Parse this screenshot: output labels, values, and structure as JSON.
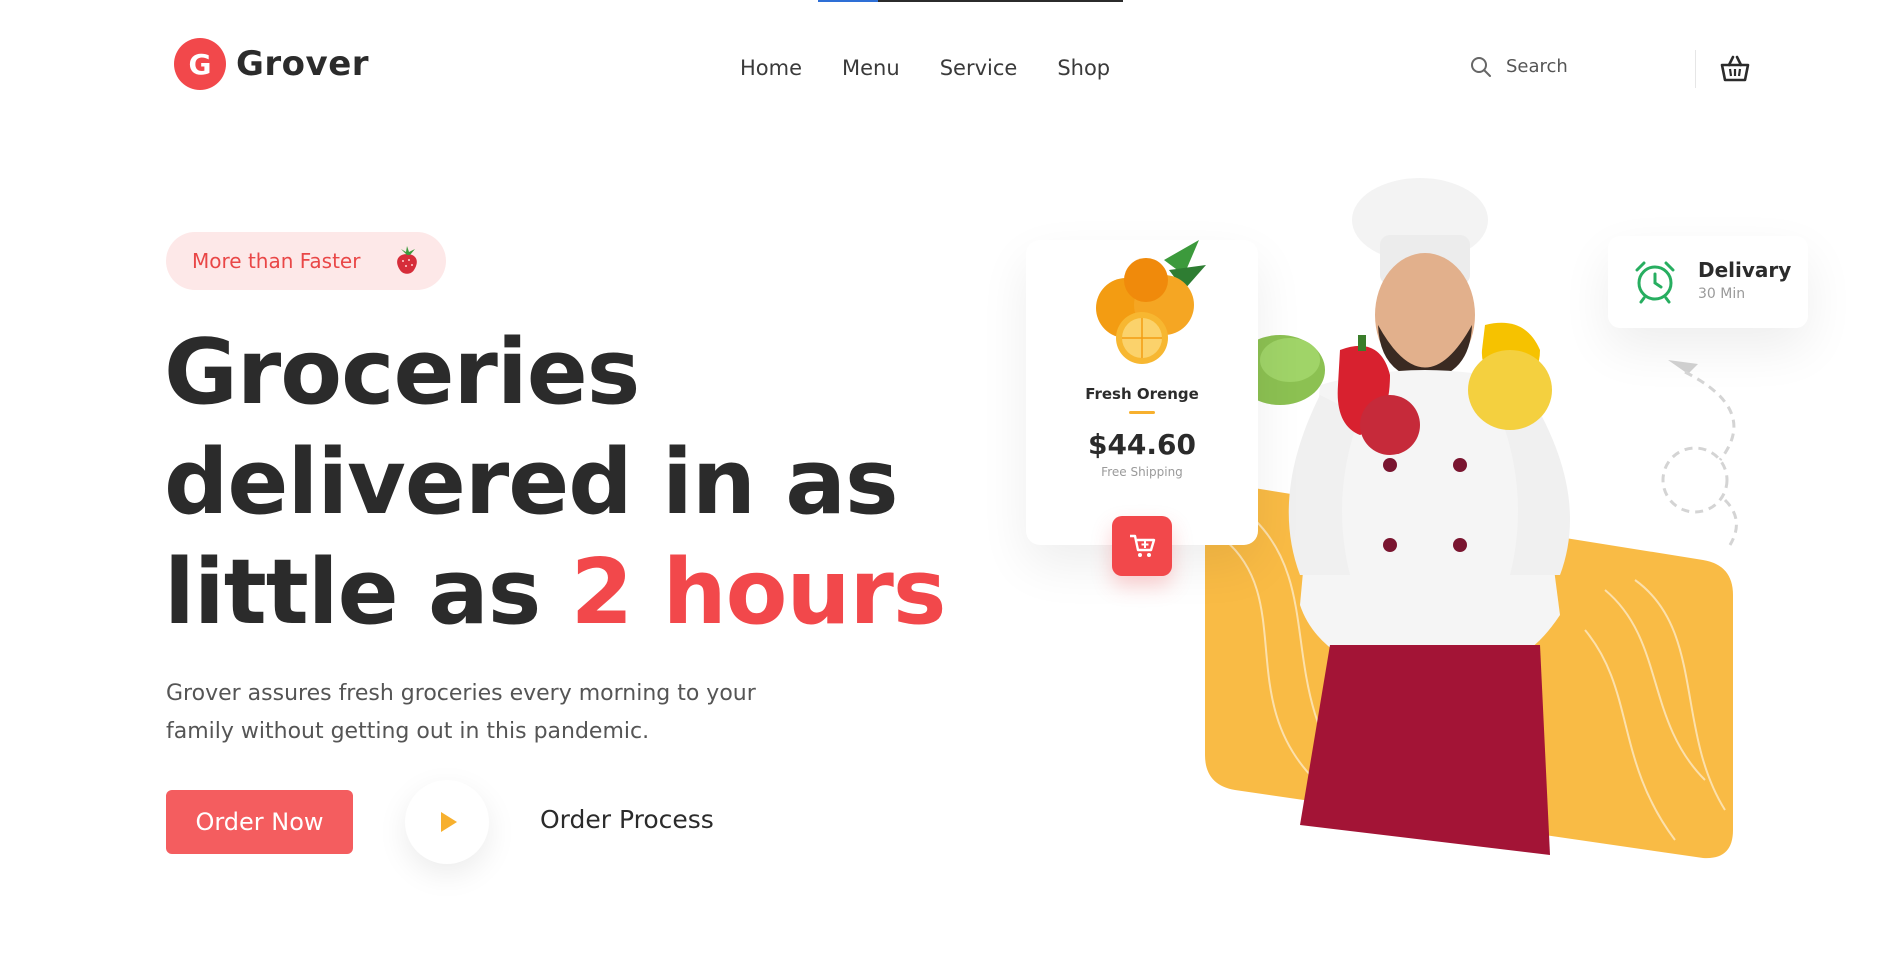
{
  "brand": {
    "name": "Grover",
    "logo_letter": "G",
    "accent": "#f2484b"
  },
  "nav": {
    "items": [
      "Home",
      "Menu",
      "Service",
      "Shop"
    ]
  },
  "search": {
    "placeholder": "Search"
  },
  "hero": {
    "badge": "More than Faster",
    "headline_line1": "Groceries",
    "headline_line2": "delivered in as",
    "headline_line3_prefix": "little as ",
    "headline_highlight": "2 hours",
    "description_line1": "Grover assures fresh groceries every morning to your",
    "description_line2": "family without getting out in this pandemic.",
    "primary_button": "Order Now",
    "secondary_link": "Order Process"
  },
  "product_card": {
    "name": "Fresh Orenge",
    "price": "$44.60",
    "shipping": "Free Shipping"
  },
  "delivery_card": {
    "title": "Delivary",
    "subtitle": "30 Min"
  },
  "colors": {
    "accent": "#f2484b",
    "button": "#f45d5f",
    "yellow": "#f9bb45",
    "green": "#27ae60"
  },
  "icons": [
    "search-icon",
    "basket-icon",
    "strawberry-icon",
    "play-icon",
    "cart-plus-icon",
    "alarm-clock-icon"
  ]
}
